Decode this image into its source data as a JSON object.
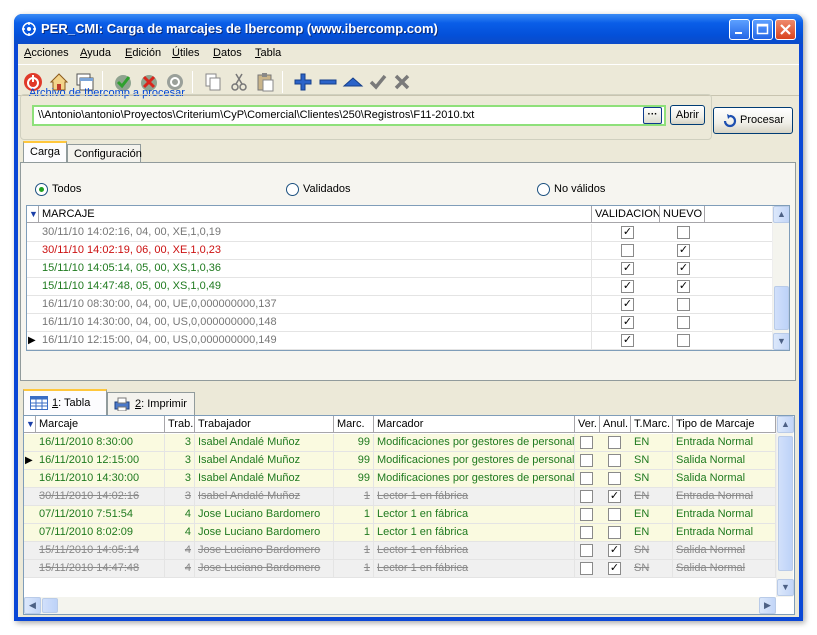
{
  "window": {
    "title": "PER_CMI: Carga de marcajes de Ibercomp (www.ibercomp.com)"
  },
  "menu": [
    {
      "label": "Acciones",
      "u": "A"
    },
    {
      "label": "Ayuda",
      "u": "y"
    },
    {
      "label": "Edición",
      "u": "E"
    },
    {
      "label": "Útiles",
      "u": "Ú"
    },
    {
      "label": "Datos",
      "u": "D"
    },
    {
      "label": "Tabla",
      "u": "T"
    }
  ],
  "file": {
    "group_label": "Archivo de Ibercomp a procesar",
    "path": "\\\\Antonio\\antonio\\Proyectos\\Criterium\\CyP\\Comercial\\Clientes\\250\\Registros\\F11-2010.txt",
    "browse_label": "···",
    "open_label": "Abrir",
    "process_label": "Procesar"
  },
  "top_tabs": [
    "Carga",
    "Configuración"
  ],
  "filter": {
    "options": [
      "Todos",
      "Validados",
      "No válidos"
    ],
    "selected": "Todos"
  },
  "raw_grid": {
    "columns": [
      "MARCAJE",
      "VALIDACION",
      "NUEVO"
    ],
    "rows": [
      {
        "text": "30/11/10 14:02:16, 04, 00, XE,1,0,19",
        "color": "gray",
        "validacion": true,
        "nuevo": false
      },
      {
        "text": "30/11/10 14:02:19, 06, 00, XE,1,0,23",
        "color": "red",
        "validacion": false,
        "nuevo": true
      },
      {
        "text": "15/11/10 14:05:14, 05, 00, XS,1,0,36",
        "color": "green",
        "validacion": true,
        "nuevo": true
      },
      {
        "text": "15/11/10 14:47:48, 05, 00, XS,1,0,49",
        "color": "green",
        "validacion": true,
        "nuevo": true
      },
      {
        "text": "16/11/10 08:30:00, 04, 00, UE,0,000000000,137",
        "color": "gray",
        "validacion": true,
        "nuevo": false
      },
      {
        "text": "16/11/10 14:30:00, 04, 00, US,0,000000000,148",
        "color": "gray",
        "validacion": true,
        "nuevo": false
      },
      {
        "text": "16/11/10 12:15:00, 04, 00, US,0,000000000,149",
        "color": "gray",
        "validacion": true,
        "nuevo": false
      }
    ]
  },
  "bottom_tabs": [
    {
      "num": "1",
      "label": ": Tabla"
    },
    {
      "num": "2",
      "label": ": Imprimir"
    }
  ],
  "table": {
    "columns": [
      "Marcaje",
      "Trab.",
      "Trabajador",
      "Marc.",
      "Marcador",
      "Ver.",
      "Anul.",
      "T.Marc.",
      "Tipo de Marcaje"
    ],
    "rows": [
      {
        "marcaje": "16/11/2010 8:30:00",
        "trab": "3",
        "trabajador": "Isabel Andalé Muñoz",
        "marc": "99",
        "marcador": "Modificaciones por gestores de personal",
        "ver": false,
        "anul": false,
        "tmarc": "EN",
        "tipo": "Entrada Normal",
        "style": "green"
      },
      {
        "marcaje": "16/11/2010 12:15:00",
        "trab": "3",
        "trabajador": "Isabel Andalé Muñoz",
        "marc": "99",
        "marcador": "Modificaciones por gestores de personal",
        "ver": false,
        "anul": false,
        "tmarc": "SN",
        "tipo": "Salida Normal",
        "style": "green"
      },
      {
        "marcaje": "16/11/2010 14:30:00",
        "trab": "3",
        "trabajador": "Isabel Andalé Muñoz",
        "marc": "99",
        "marcador": "Modificaciones por gestores de personal",
        "ver": false,
        "anul": false,
        "tmarc": "SN",
        "tipo": "Salida Normal",
        "style": "green"
      },
      {
        "marcaje": "30/11/2010 14:02:16",
        "trab": "3",
        "trabajador": "Isabel Andalé Muñoz",
        "marc": "1",
        "marcador": "Lector 1 en fábrica",
        "ver": false,
        "anul": true,
        "tmarc": "EN",
        "tipo": "Entrada Normal",
        "style": "strike"
      },
      {
        "marcaje": "07/11/2010 7:51:54",
        "trab": "4",
        "trabajador": "Jose Luciano Bardomero",
        "marc": "1",
        "marcador": "Lector 1 en fábrica",
        "ver": false,
        "anul": false,
        "tmarc": "EN",
        "tipo": "Entrada Normal",
        "style": "green"
      },
      {
        "marcaje": "07/11/2010 8:02:09",
        "trab": "4",
        "trabajador": "Jose Luciano Bardomero",
        "marc": "1",
        "marcador": "Lector 1 en fábrica",
        "ver": false,
        "anul": false,
        "tmarc": "EN",
        "tipo": "Entrada Normal",
        "style": "green"
      },
      {
        "marcaje": "15/11/2010 14:05:14",
        "trab": "4",
        "trabajador": "Jose Luciano Bardomero",
        "marc": "1",
        "marcador": "Lector 1 en fábrica",
        "ver": false,
        "anul": true,
        "tmarc": "SN",
        "tipo": "Salida Normal",
        "style": "strike"
      },
      {
        "marcaje": "15/11/2010 14:47:48",
        "trab": "4",
        "trabajador": "Jose Luciano Bardomero",
        "marc": "1",
        "marcador": "Lector 1 en fábrica",
        "ver": false,
        "anul": true,
        "tmarc": "SN",
        "tipo": "Salida Normal",
        "style": "strike"
      }
    ]
  },
  "colors": {
    "valid_text": "#1f7a1f",
    "invalid_text": "#cc1111",
    "neutral_text": "#777777",
    "row_highlight": "#fafae0",
    "xp_blue": "#0a47d6"
  }
}
